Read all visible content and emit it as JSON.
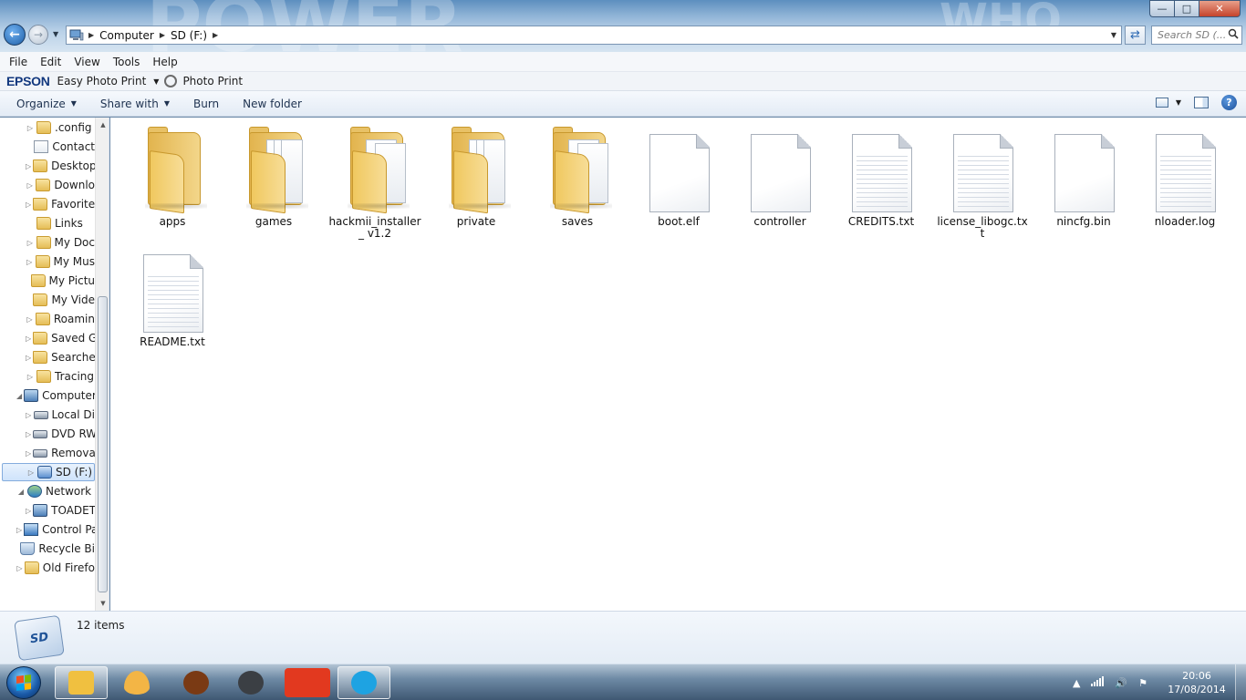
{
  "window": {
    "minimize_glyph": "—",
    "maximize_glyph": "□",
    "close_glyph": "✕"
  },
  "address": {
    "crumbs": [
      "Computer",
      "SD (F:)"
    ],
    "search_placeholder": "Search SD (..."
  },
  "menu": [
    "File",
    "Edit",
    "View",
    "Tools",
    "Help"
  ],
  "epson": {
    "brand": "EPSON",
    "easy_photo_print": "Easy Photo Print",
    "photo_print": "Photo Print"
  },
  "commands": {
    "organize": "Organize",
    "share_with": "Share with",
    "burn": "Burn",
    "new_folder": "New folder",
    "help_glyph": "?"
  },
  "tree": [
    {
      "label": ".config",
      "icon": "folder-icon",
      "arrow": "▷",
      "indent": 2
    },
    {
      "label": "Contact",
      "icon": "contacts-folder-icon",
      "arrow": "",
      "indent": 2
    },
    {
      "label": "Desktop",
      "icon": "desktop-folder-icon",
      "arrow": "▷",
      "indent": 2
    },
    {
      "label": "Downlo",
      "icon": "downloads-folder-icon",
      "arrow": "▷",
      "indent": 2
    },
    {
      "label": "Favorite",
      "icon": "favorites-folder-icon",
      "arrow": "▷",
      "indent": 2
    },
    {
      "label": "Links",
      "icon": "links-folder-icon",
      "arrow": "",
      "indent": 2
    },
    {
      "label": "My Doc",
      "icon": "documents-folder-icon",
      "arrow": "▷",
      "indent": 2
    },
    {
      "label": "My Mus",
      "icon": "music-folder-icon",
      "arrow": "▷",
      "indent": 2
    },
    {
      "label": "My Pictu",
      "icon": "pictures-folder-icon",
      "arrow": "",
      "indent": 2
    },
    {
      "label": "My Vide",
      "icon": "videos-folder-icon",
      "arrow": "",
      "indent": 2
    },
    {
      "label": "Roamin",
      "icon": "folder-icon",
      "arrow": "▷",
      "indent": 2
    },
    {
      "label": "Saved G",
      "icon": "saved-games-folder-icon",
      "arrow": "▷",
      "indent": 2
    },
    {
      "label": "Searche",
      "icon": "searches-folder-icon",
      "arrow": "▷",
      "indent": 2
    },
    {
      "label": "Tracing",
      "icon": "folder-icon",
      "arrow": "▷",
      "indent": 2
    },
    {
      "label": "Computer",
      "icon": "computer-icon",
      "arrow": "◢",
      "indent": 1
    },
    {
      "label": "Local Di",
      "icon": "local-disk-icon",
      "arrow": "▷",
      "indent": 2
    },
    {
      "label": "DVD RW",
      "icon": "dvd-drive-icon",
      "arrow": "▷",
      "indent": 2
    },
    {
      "label": "Remova",
      "icon": "removable-disk-icon",
      "arrow": "▷",
      "indent": 2
    },
    {
      "label": "SD (F:)",
      "icon": "sd-card-icon",
      "arrow": "▷",
      "indent": 2,
      "selected": true
    },
    {
      "label": "Network",
      "icon": "network-icon",
      "arrow": "◢",
      "indent": 1
    },
    {
      "label": "TOADET",
      "icon": "network-computer-icon",
      "arrow": "▷",
      "indent": 2
    },
    {
      "label": "Control Pa",
      "icon": "control-panel-icon",
      "arrow": "▷",
      "indent": 1
    },
    {
      "label": "Recycle Bi",
      "icon": "recycle-bin-icon",
      "arrow": "",
      "indent": 1
    },
    {
      "label": "Old Firefo",
      "icon": "folder-icon",
      "arrow": "▷",
      "indent": 1
    }
  ],
  "items": [
    {
      "label": "apps",
      "kind": "folder-empty"
    },
    {
      "label": "games",
      "kind": "folder-full"
    },
    {
      "label": "hackmii_installer_ v1.2",
      "kind": "folder-docs"
    },
    {
      "label": "private",
      "kind": "folder-full"
    },
    {
      "label": "saves",
      "kind": "folder-docs"
    },
    {
      "label": "boot.elf",
      "kind": "file"
    },
    {
      "label": "controller",
      "kind": "file"
    },
    {
      "label": "CREDITS.txt",
      "kind": "text"
    },
    {
      "label": "license_libogc.txt",
      "kind": "text"
    },
    {
      "label": "nincfg.bin",
      "kind": "file"
    },
    {
      "label": "nloader.log",
      "kind": "text"
    },
    {
      "label": "README.txt",
      "kind": "text"
    }
  ],
  "details": {
    "item_count": "12 items",
    "sd_badge": "SD"
  },
  "taskbar": {
    "apps": [
      {
        "name": "explorer-taskbar-button",
        "icon": "explorer-icon",
        "color": "#f0c040",
        "active": true
      },
      {
        "name": "app-taskbar-button-2",
        "icon": "half-moon-icon",
        "color": "#f3b545",
        "active": false
      },
      {
        "name": "app-taskbar-button-3",
        "icon": "headphones-icon",
        "color": "#7a3a14",
        "active": false
      },
      {
        "name": "steam-taskbar-button",
        "icon": "steam-icon",
        "color": "#3b3f44",
        "active": false
      },
      {
        "name": "app-taskbar-button-5",
        "icon": "red-app-icon",
        "color": "#e2391f",
        "active": false
      },
      {
        "name": "skype-taskbar-button",
        "icon": "skype-icon",
        "color": "#1ea3e2",
        "active": true
      }
    ],
    "time": "20:06",
    "date": "17/08/2014"
  }
}
